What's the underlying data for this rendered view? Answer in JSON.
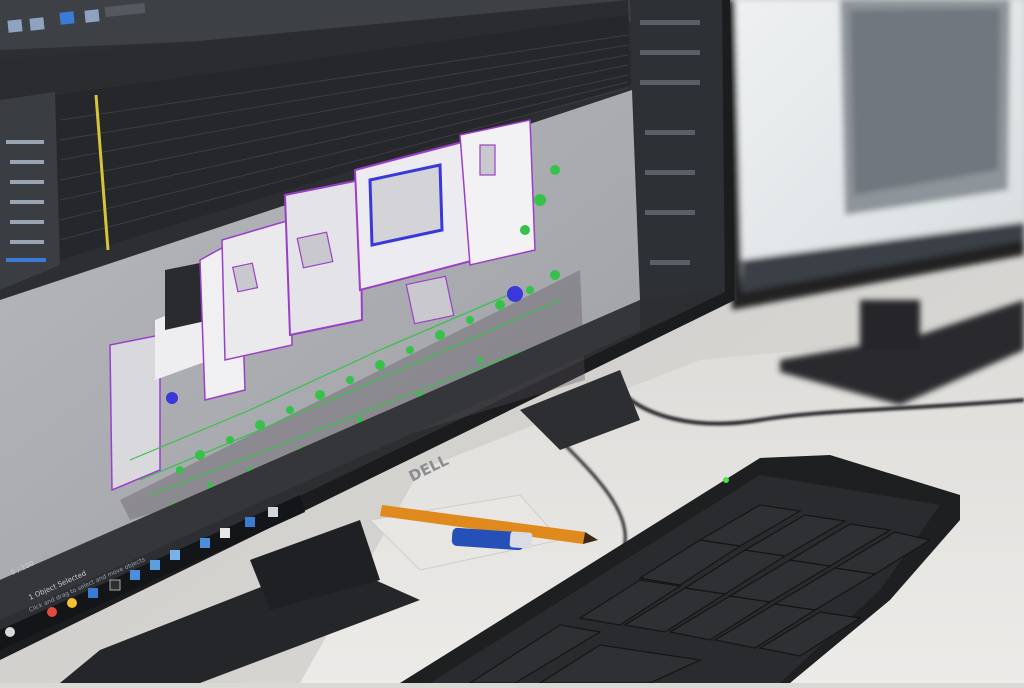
{
  "photo": {
    "monitor_brand": "DELL",
    "status_text": "1 Object Selected",
    "status_hint": "Click and drag to select and move objects",
    "frame_counter": "0 / 100"
  },
  "colors": {
    "wall": "#c4c2c0",
    "desk": "#e6e5e2",
    "bezel": "#1b1c1e",
    "viewport_bg": "#a9abaf",
    "panel_dark": "#34363a",
    "building_white": "#e9e9eb",
    "outline_purple": "#9b3fc9",
    "outline_blue": "#3a38d8",
    "vegetation_green": "#36c24a",
    "keyboard": "#1e1f21",
    "pencil_orange": "#e08a1e",
    "eraser_blue": "#2450b8"
  }
}
